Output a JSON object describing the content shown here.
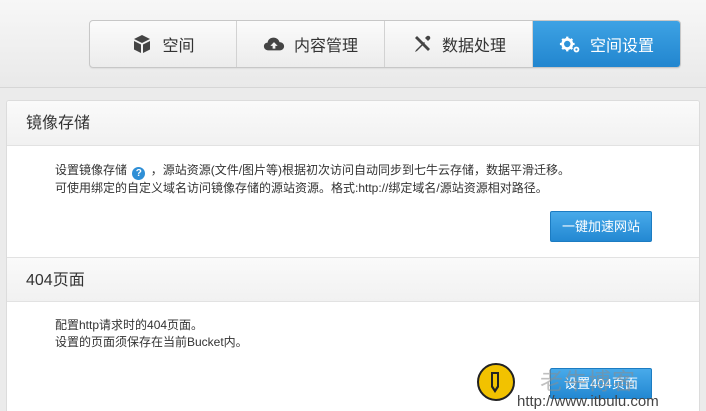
{
  "nav": {
    "tabs": [
      {
        "label": "空间",
        "icon": "box-icon",
        "active": false
      },
      {
        "label": "内容管理",
        "icon": "cloud-upload-icon",
        "active": false
      },
      {
        "label": "数据处理",
        "icon": "tools-icon",
        "active": false
      },
      {
        "label": "空间设置",
        "icon": "gears-icon",
        "active": true
      }
    ]
  },
  "mirror": {
    "title": "镜像存储",
    "line1_before": "设置镜像存储",
    "line1_after": "，源站资源(文件/图片等)根据初次访问自动同步到七牛云存储，数据平滑迁移。",
    "line2": "可使用绑定的自定义域名访问镜像存储的源站资源。格式:http://绑定域名/源站资源相对路径。",
    "help": "?",
    "button": "一键加速网站"
  },
  "page404": {
    "title": "404页面",
    "line1": "配置http请求时的404页面。",
    "line2": "设置的页面须保存在当前Bucket内。",
    "button": "设置404页面"
  },
  "watermark": {
    "text": "老牛博客",
    "url": "http://www.itbulu.com"
  },
  "colors": {
    "accent": "#2286cf",
    "page_bg": "#ebebeb"
  }
}
